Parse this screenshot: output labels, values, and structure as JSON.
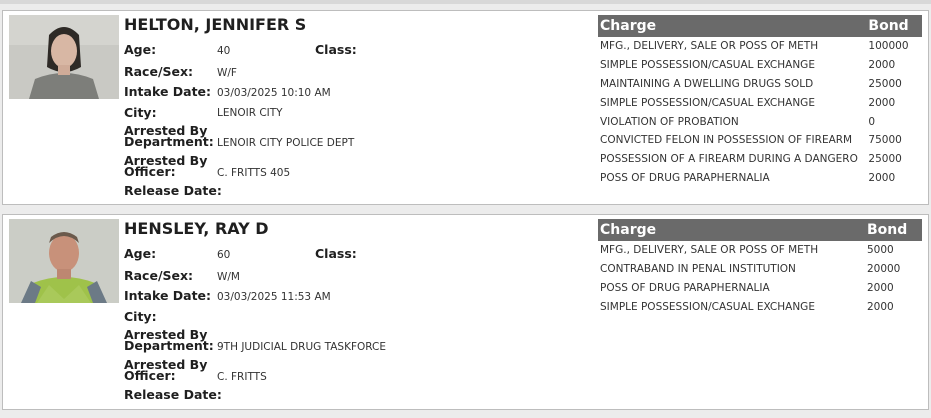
{
  "labels": {
    "age": "Age:",
    "class": "Class:",
    "race_sex": "Race/Sex:",
    "intake_date": "Intake Date:",
    "city": "City:",
    "arrested_by": "Arrested By",
    "department": "Department:",
    "officer": "Officer:",
    "release_date": "Release Date:",
    "charge_header": "Charge",
    "bond_header": "Bond"
  },
  "inmates": [
    {
      "name": "HELTON, JENNIFER S",
      "age": "40",
      "class": "",
      "race_sex": "W/F",
      "intake_date": "03/03/2025 10:10 AM",
      "city": "LENOIR CITY",
      "department": "LENOIR CITY POLICE DEPT",
      "officer": "C. FRITTS 405",
      "release_date": "",
      "charges": [
        {
          "charge": "MFG., DELIVERY, SALE OR POSS OF METH",
          "bond": "100000"
        },
        {
          "charge": "SIMPLE POSSESSION/CASUAL EXCHANGE",
          "bond": "2000"
        },
        {
          "charge": "MAINTAINING A DWELLING DRUGS SOLD",
          "bond": "25000"
        },
        {
          "charge": "SIMPLE POSSESSION/CASUAL EXCHANGE",
          "bond": "2000"
        },
        {
          "charge": "VIOLATION OF PROBATION",
          "bond": "0"
        },
        {
          "charge": "CONVICTED FELON IN POSSESSION OF FIREARM",
          "bond": "75000"
        },
        {
          "charge": "POSSESSION OF A FIREARM DURING A DANGERO",
          "bond": "25000"
        },
        {
          "charge": "POSS OF DRUG PARAPHERNALIA",
          "bond": "2000"
        }
      ]
    },
    {
      "name": "HENSLEY, RAY D",
      "age": "60",
      "class": "",
      "race_sex": "W/M",
      "intake_date": "03/03/2025 11:53 AM",
      "city": "",
      "department": "9TH JUDICIAL DRUG TASKFORCE",
      "officer": "C. FRITTS",
      "release_date": "",
      "charges": [
        {
          "charge": "MFG., DELIVERY, SALE OR POSS OF METH",
          "bond": "5000"
        },
        {
          "charge": "CONTRABAND IN PENAL INSTITUTION",
          "bond": "20000"
        },
        {
          "charge": "POSS OF DRUG PARAPHERNALIA",
          "bond": "2000"
        },
        {
          "charge": "SIMPLE POSSESSION/CASUAL EXCHANGE",
          "bond": "2000"
        }
      ]
    }
  ],
  "colors": {
    "header_bg": "#6a6a6a",
    "page_bg": "#ececec",
    "card_bg": "#ffffff"
  }
}
